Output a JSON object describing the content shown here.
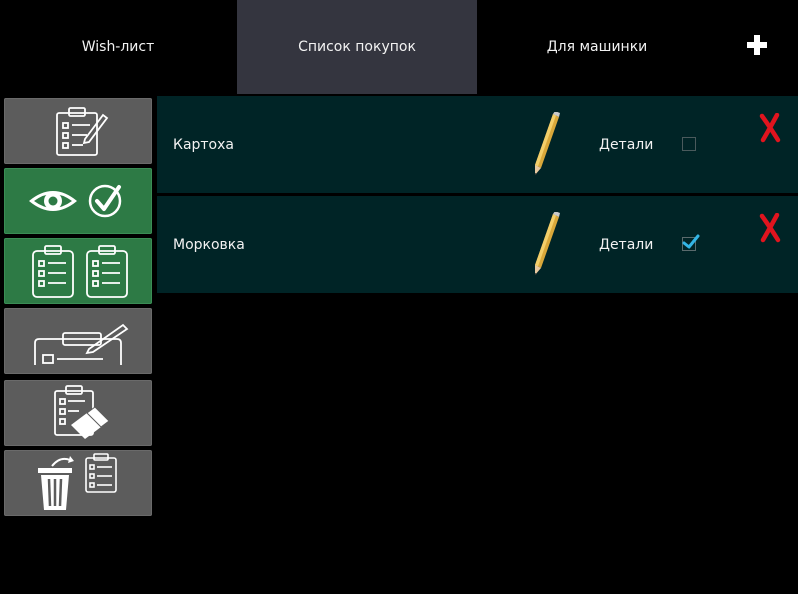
{
  "tabs": [
    {
      "label": "Wish-лист",
      "active": false
    },
    {
      "label": "Список покупок",
      "active": true
    },
    {
      "label": "Для машинки",
      "active": false
    }
  ],
  "add_icon": "plus-icon",
  "sidebar": [
    {
      "name": "edit-list-button",
      "icon": "clipboard-pencil-icon",
      "state": "default"
    },
    {
      "name": "view-checked-button",
      "icon": "eye-check-icon",
      "state": "active"
    },
    {
      "name": "copy-list-button",
      "icon": "two-clipboards-icon",
      "state": "active"
    },
    {
      "name": "edit-field-button",
      "icon": "card-pencil-icon",
      "state": "default"
    },
    {
      "name": "clear-list-button",
      "icon": "clipboard-eraser-icon",
      "state": "default"
    },
    {
      "name": "delete-list-button",
      "icon": "trash-clipboard-icon",
      "state": "default"
    }
  ],
  "items": [
    {
      "name": "Картоха",
      "details_label": "Детали",
      "checked": false
    },
    {
      "name": "Морковка",
      "details_label": "Детали",
      "checked": true
    }
  ],
  "colors": {
    "background": "#000000",
    "active_tab": "#34353f",
    "row_bg": "#002426",
    "sidebar_default": "#5c5c5c",
    "sidebar_active": "#2d7a45",
    "check_accent": "#33b5e5",
    "delete_red": "#e0141e"
  }
}
